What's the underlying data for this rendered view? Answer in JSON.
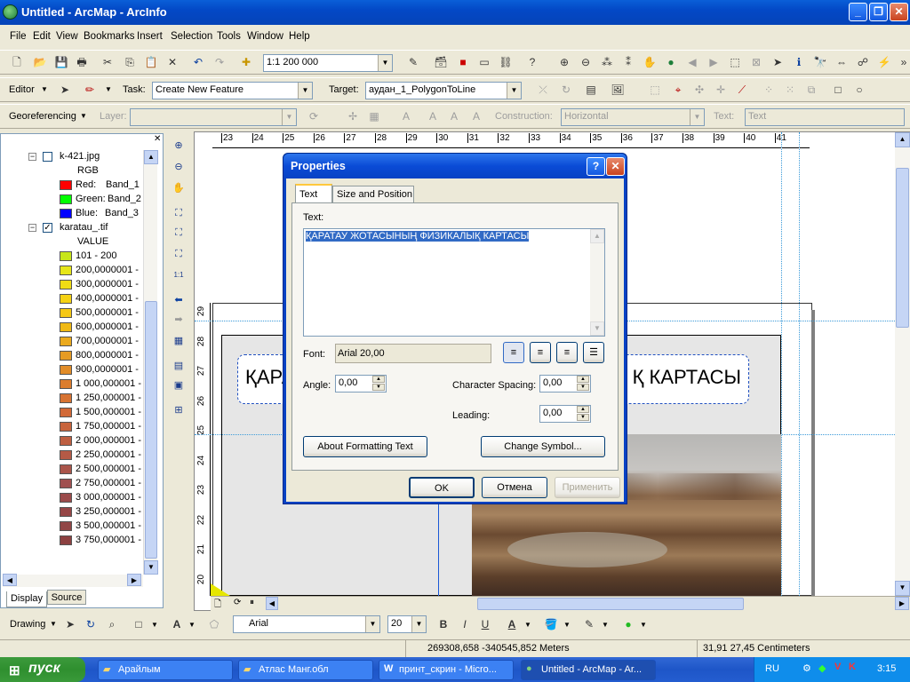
{
  "window": {
    "title": "Untitled - ArcMap - ArcInfo"
  },
  "menu": [
    "File",
    "Edit",
    "View",
    "Bookmarks",
    "Insert",
    "Selection",
    "Tools",
    "Window",
    "Help"
  ],
  "standard_toolbar": {
    "scale": "1:1 200 000"
  },
  "editor_toolbar": {
    "editor_label": "Editor",
    "task_label": "Task:",
    "task_value": "Create New Feature",
    "target_label": "Target:",
    "target_value": "аудан_1_PolygonToLine"
  },
  "georef_toolbar": {
    "georef_label": "Georeferencing",
    "layer_label": "Layer:",
    "construction_label": "Construction:",
    "construction_value": "Horizontal",
    "text_label": "Text:",
    "text_value": "Text"
  },
  "toc": {
    "layer1": {
      "name": "k-421.jpg",
      "type": "RGB",
      "bands": [
        {
          "label": "Red:",
          "band": "Band_1",
          "color": "#FF0000"
        },
        {
          "label": "Green:",
          "band": "Band_2",
          "color": "#00FF00"
        },
        {
          "label": "Blue:",
          "band": "Band_3",
          "color": "#0000FF"
        }
      ]
    },
    "layer2": {
      "name": "karatau_.tif",
      "field": "VALUE",
      "classes": [
        {
          "label": "101 - 200",
          "color": "#C8E619"
        },
        {
          "label": "200,0000001 -",
          "color": "#E6E619"
        },
        {
          "label": "300,0000001 -",
          "color": "#F0DC14"
        },
        {
          "label": "400,0000001 -",
          "color": "#F5D214"
        },
        {
          "label": "500,0000001 -",
          "color": "#F5C814"
        },
        {
          "label": "600,0000001 -",
          "color": "#F0B914"
        },
        {
          "label": "700,0000001 -",
          "color": "#EBAA1E"
        },
        {
          "label": "800,0000001 -",
          "color": "#E69B23"
        },
        {
          "label": "900,0000001 -",
          "color": "#E18C28"
        },
        {
          "label": "1 000,000001 -",
          "color": "#DC7D2D"
        },
        {
          "label": "1 250,000001 -",
          "color": "#D77332"
        },
        {
          "label": "1 500,000001 -",
          "color": "#D26937"
        },
        {
          "label": "1 750,000001 -",
          "color": "#C8643C"
        },
        {
          "label": "2 000,000001 -",
          "color": "#BE5F41"
        },
        {
          "label": "2 250,000001 -",
          "color": "#B45A46"
        },
        {
          "label": "2 500,000001 -",
          "color": "#AA554B"
        },
        {
          "label": "2 750,000001 -",
          "color": "#A05050"
        },
        {
          "label": "3 000,000001 -",
          "color": "#9B4B4B"
        },
        {
          "label": "3 250,000001 -",
          "color": "#964646"
        },
        {
          "label": "3 500,000001 -",
          "color": "#914646"
        },
        {
          "label": "3 750,000001 -",
          "color": "#8C4141"
        }
      ]
    },
    "tabs": [
      "Display",
      "Source"
    ]
  },
  "ruler": {
    "top_ticks": [
      "23",
      "24",
      "25",
      "26",
      "27",
      "28",
      "29",
      "30",
      "31",
      "32",
      "33",
      "34",
      "35",
      "36",
      "37",
      "38",
      "39",
      "40",
      "41"
    ],
    "left_ticks": [
      "29",
      "28",
      "27",
      "26",
      "25",
      "24",
      "23",
      "22",
      "21",
      "20"
    ]
  },
  "map": {
    "title_left": "ҚАРА",
    "title_right": "Қ КАРТАСЫ"
  },
  "dialog": {
    "title": "Properties",
    "tabs": [
      "Text",
      "Size and Position"
    ],
    "text_label": "Text:",
    "text_value": "ҚАРАТАУ ЖОТАСЫНЫҢ ФИЗИКАЛЫҚ КАРТАСЫ",
    "font_label": "Font:",
    "font_value": "Arial 20,00",
    "angle_label": "Angle:",
    "angle_value": "0,00",
    "char_spacing_label": "Character Spacing:",
    "char_spacing_value": "0,00",
    "leading_label": "Leading:",
    "leading_value": "0,00",
    "about_button": "About Formatting Text",
    "change_symbol_button": "Change Symbol...",
    "ok_button": "OK",
    "cancel_button": "Отмена",
    "apply_button": "Применить"
  },
  "drawing_toolbar": {
    "label": "Drawing",
    "font": "Arial",
    "size": "20",
    "bold": "B",
    "italic": "I",
    "underline": "U",
    "text_tool": "A"
  },
  "status": {
    "coords": "269308,658  -340545,852 Meters",
    "page_coords": "31,91  27,45 Centimeters"
  },
  "taskbar": {
    "start": "пуск",
    "tasks": [
      "Арайлым",
      "Атлас Манг.обл",
      "принт_скрин - Micro...",
      "Untitled - ArcMap - Ar..."
    ],
    "lang": "RU",
    "clock": "3:15"
  },
  "colors": {
    "title_bar": "#0842C4",
    "taskbar": "#245DD0",
    "start": "#2F8F2F",
    "selection": "#316AC5"
  }
}
